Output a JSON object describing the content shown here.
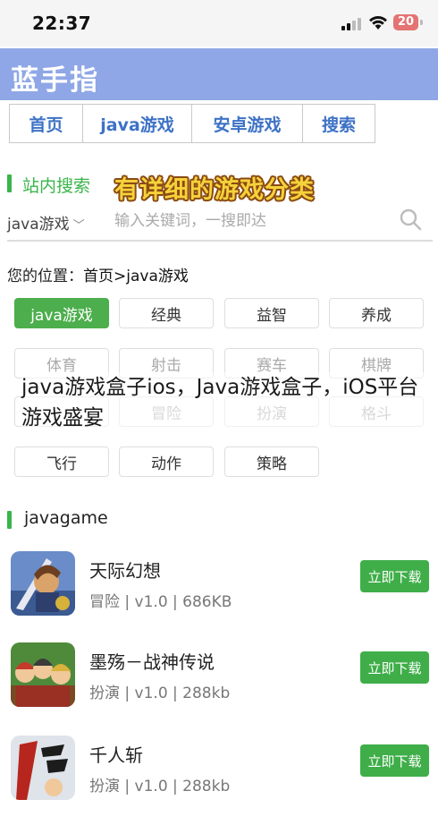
{
  "status": {
    "time": "22:37",
    "battery": "20"
  },
  "site": {
    "title": "蓝手指"
  },
  "nav": [
    {
      "label": "首页"
    },
    {
      "label": "java游戏"
    },
    {
      "label": "安卓游戏"
    },
    {
      "label": "搜索"
    }
  ],
  "search": {
    "section_label": "站内搜索",
    "promo_text": "有详细的游戏分类",
    "category_select": "java游戏",
    "placeholder": "输入关键词，一搜即达"
  },
  "location": {
    "prefix": "您的位置：",
    "path": "首页>java游戏"
  },
  "categories": [
    {
      "label": "java游戏",
      "active": true
    },
    {
      "label": "经典"
    },
    {
      "label": "益智"
    },
    {
      "label": "养成"
    },
    {
      "label": "体育"
    },
    {
      "label": "射击"
    },
    {
      "label": "赛车"
    },
    {
      "label": "棋牌"
    },
    {
      "label": ""
    },
    {
      "label": "冒险"
    },
    {
      "label": "扮演"
    },
    {
      "label": "格斗"
    },
    {
      "label": "飞行"
    },
    {
      "label": "动作"
    },
    {
      "label": "策略"
    }
  ],
  "overlay_caption": "java游戏盒子ios，Java游戏盒子，iOS平台游戏盛宴",
  "list_section": {
    "label": "javagame"
  },
  "games": [
    {
      "name": "天际幻想",
      "meta": "冒险 | v1.0 | 686KB",
      "button": "立即下载",
      "icon": "fantasy-warrior-icon"
    },
    {
      "name": "墨殇－战神传说",
      "meta": "扮演 | v1.0 | 288kb",
      "button": "立即下载",
      "icon": "heroes-group-icon"
    },
    {
      "name": "千人斩",
      "meta": "扮演 | v1.0 | 288kb",
      "button": "立即下载",
      "icon": "thousand-slash-icon"
    }
  ],
  "colors": {
    "header": "#8fa7e6",
    "accent_green": "#39b54a",
    "nav_text": "#3d72c6",
    "promo_yellow": "#f6d23a"
  }
}
